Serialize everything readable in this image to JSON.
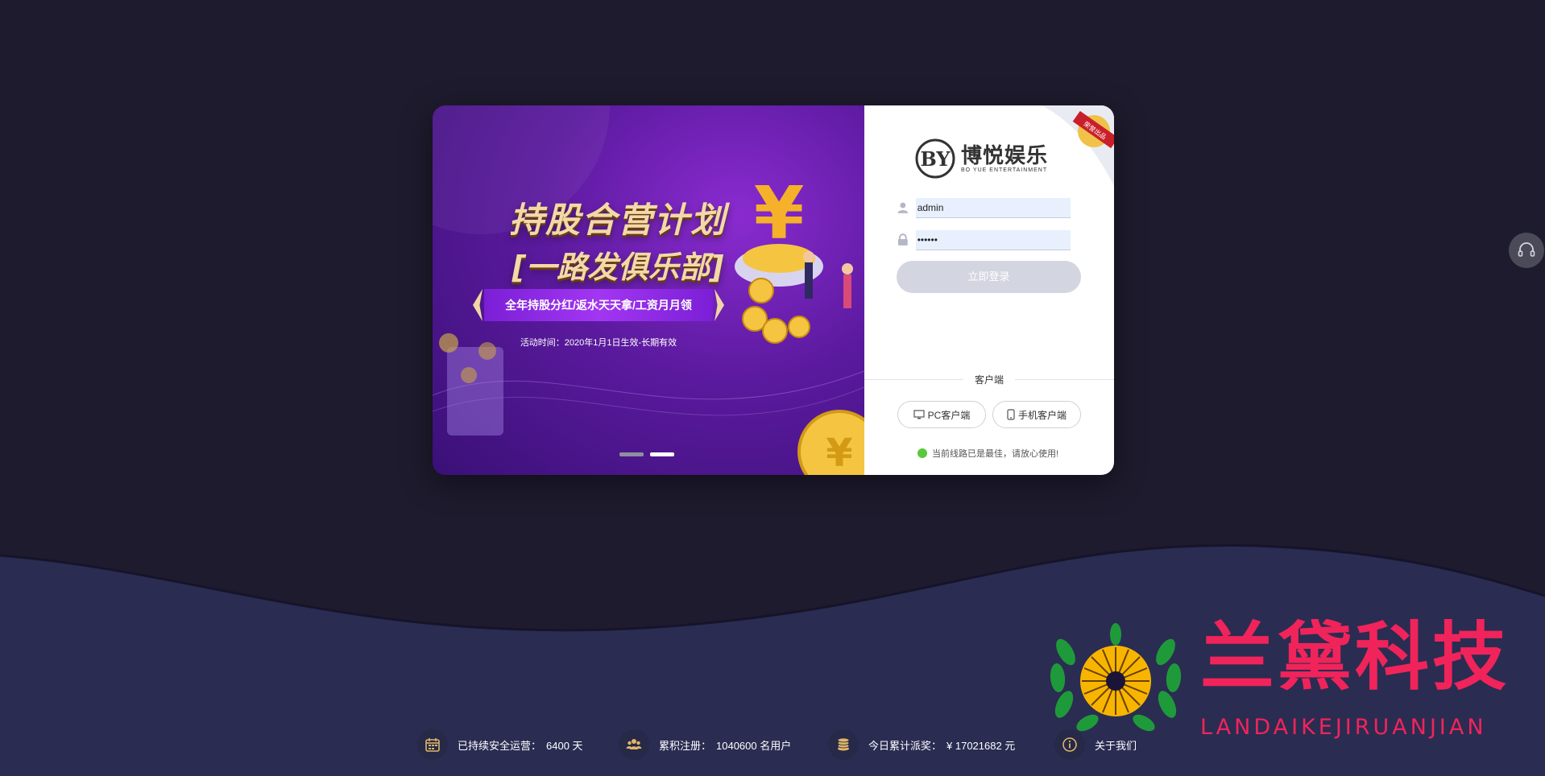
{
  "banner": {
    "title": "持股合营计划",
    "subtitle": "[一路发俱乐部]",
    "ribbon": "全年持股分红/返水天天拿/工资月月领",
    "date": "活动时间：2020年1月1日生效-长期有效",
    "slides": 2,
    "active_slide": 1
  },
  "brand": {
    "name": "博悦娱乐",
    "name_en": "BO YUE ENTERTAINMENT",
    "corner_badge": "荣誉出品"
  },
  "login": {
    "username": "admin",
    "password": "••••••",
    "button": "立即登录"
  },
  "client": {
    "divider_label": "客户端",
    "pc_button": "PC客户端",
    "mobile_button": "手机客户端",
    "status": "当前线路已是最佳，请放心使用!"
  },
  "footer": {
    "stat1_label": "已持续安全运营：",
    "stat1_value": "6400 天",
    "stat2_label": "累积注册：",
    "stat2_value": "1040600 名用户",
    "stat3_label": "今日累计派奖：",
    "stat3_value": "¥ 17021682 元",
    "about": "关于我们"
  },
  "watermark": {
    "cn": "兰黛科技",
    "en": "LANDAIKEJIRUANJIAN"
  },
  "colors": {
    "page_bg": "#1e1b2e",
    "wave_bg": "#2b2c52",
    "banner_purple": "#5b1a9e",
    "gold": "#f2d9a8",
    "login_button": "#d3d5e0",
    "status_green": "#5ac83c",
    "watermark_red": "#f0245a"
  },
  "icons": {
    "user_field": "user-icon",
    "password_field": "lock-icon",
    "pc": "monitor-icon",
    "mobile": "phone-icon",
    "support": "headset-icon",
    "stat1": "calendar-icon",
    "stat2": "users-icon",
    "stat3": "coins-icon",
    "about": "info-icon"
  }
}
